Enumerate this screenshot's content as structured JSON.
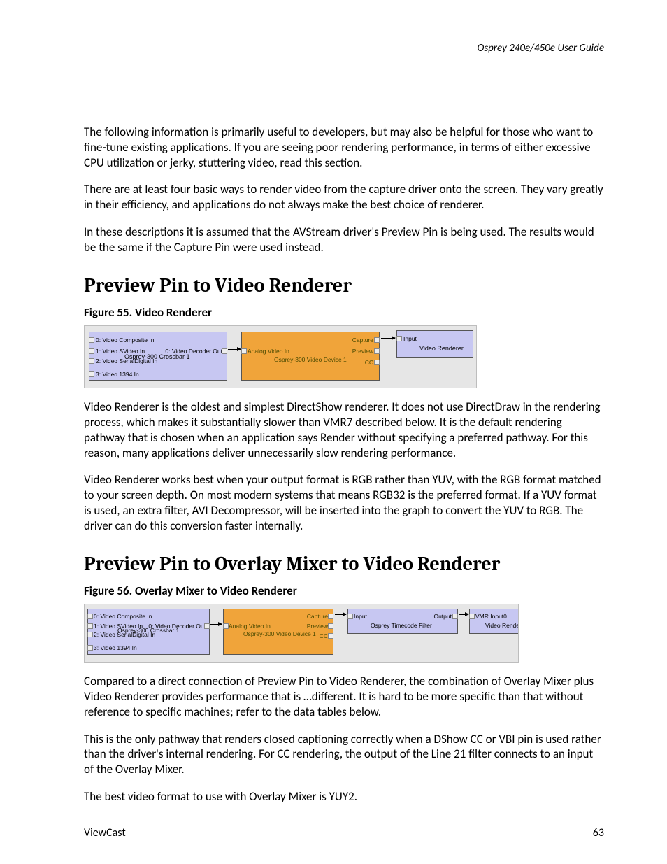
{
  "header": {
    "title": "Osprey 240e/450e User Guide"
  },
  "intro": {
    "p1": "The following information is primarily useful to developers, but may also be helpful for those who want to fine-tune existing applications. If you are seeing poor rendering performance, in terms of either excessive CPU utilization or jerky, stuttering video, read this section.",
    "p2": "There are at least four basic ways to render video from the capture driver onto the screen. They vary greatly in their efficiency, and applications do not always make the best choice of renderer.",
    "p3": "In these descriptions it is assumed that the AVStream driver's Preview Pin is being used. The results would be the same if the Capture Pin were used instead."
  },
  "section1": {
    "heading": "Preview Pin to Video Renderer",
    "figCaption": "Figure 55. Video Renderer",
    "p1": "Video Renderer is the oldest and simplest DirectShow renderer. It does not use DirectDraw in the rendering process, which makes it substantially slower than VMR7 described below. It is the default rendering pathway that is chosen when an application says Render without specifying a preferred pathway. For this reason, many applications deliver unnecessarily slow rendering performance.",
    "p2": "Video Renderer works best when your output format is RGB rather than YUV, with the RGB format matched to your screen depth. On most modern systems that means RGB32 is the preferred format. If a YUV format is used, an extra filter, AVI Decompressor, will be inserted into the graph to convert the YUV to RGB. The driver can do this conversion faster internally."
  },
  "section2": {
    "heading": "Preview Pin to Overlay Mixer to Video Renderer",
    "figCaption": "Figure 56. Overlay Mixer to Video Renderer",
    "p1": "Compared to a direct connection of Preview Pin to Video Renderer, the combination of Overlay Mixer plus Video Renderer provides performance that is …different. It is hard to be more specific than that without reference to specific machines; refer to the data tables below.",
    "p2": "This is the only pathway that renders closed captioning correctly when a DShow CC or VBI pin is used rather than the driver's internal rendering. For CC rendering, the output of the Line 21 filter connects to an input of the Overlay Mixer.",
    "p3": "The best video format to use with Overlay Mixer is YUY2."
  },
  "diagram1": {
    "crossbar": {
      "title": "Osprey-300 Crossbar 1",
      "in0": "0: Video Composite In",
      "in1": "1: Video SVideo In",
      "in2": "2: Video SerialDigital In",
      "in3": "3: Video 1394 In",
      "out": "0: Video Decoder Out"
    },
    "device": {
      "title": "Osprey-300 Video Device 1",
      "inLabel": "Analog Video In",
      "out0": "Capture",
      "out1": "Preview",
      "out2": "CC"
    },
    "renderer": {
      "title": "Video Renderer",
      "inLabel": "Input"
    }
  },
  "diagram2": {
    "crossbar": {
      "title": "Osprey-300 Crossbar 1",
      "in0": "0: Video Composite In",
      "in1": "1: Video SVideo In",
      "in2": "2: Video SerialDigital In",
      "in3": "3: Video 1394 In",
      "out": "0: Video Decoder Out"
    },
    "device": {
      "title": "Osprey-300 Video Device 1",
      "inLabel": "Analog Video In",
      "out0": "Capture",
      "out1": "Preview",
      "out2": "CC"
    },
    "timecode": {
      "title": "Osprey Timecode Filter",
      "inLabel": "Input",
      "outLabel": "Output"
    },
    "vmr": {
      "title": "Video Rende",
      "inLabel": "VMR Input0"
    }
  },
  "footer": {
    "left": "ViewCast",
    "right": "63"
  }
}
